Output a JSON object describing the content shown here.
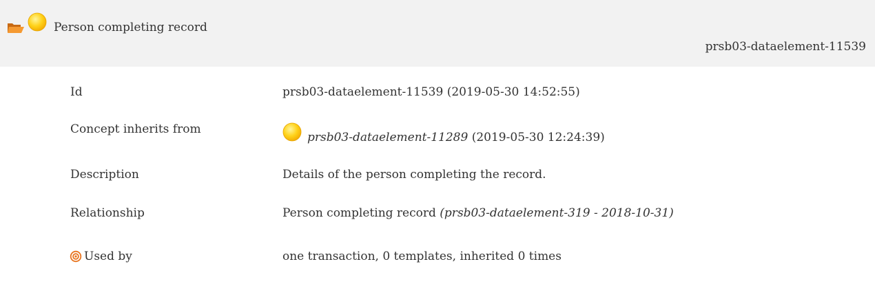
{
  "header": {
    "title": "Person completing record",
    "id_label": "prsb03-dataelement-11539",
    "folder_icon": "folder-open-icon",
    "status_icon": "status-draft-icon"
  },
  "rows": {
    "id": {
      "label": "Id",
      "value": "prsb03-dataelement-11539 (2019-05-30 14:52:55)"
    },
    "inherits": {
      "label": "Concept inherits from",
      "link": "prsb03-dataelement-11289",
      "date": " (2019-05-30 12:24:39)",
      "icon": "status-draft-icon"
    },
    "description": {
      "label": "Description",
      "value": "Details of the person completing the record."
    },
    "relationship": {
      "label": "Relationship",
      "value": "Person completing record ",
      "ref": "(prsb03-dataelement-319 - 2018-10-31)"
    },
    "usedby": {
      "label": "Used by",
      "value": "one transaction, 0 templates, inherited 0 times",
      "icon": "target-icon"
    }
  },
  "colors": {
    "header_bg": "#f2f2f2",
    "status_yellow": "#ffc400",
    "folder_orange": "#f08a24",
    "target_orange": "#e8731c"
  }
}
